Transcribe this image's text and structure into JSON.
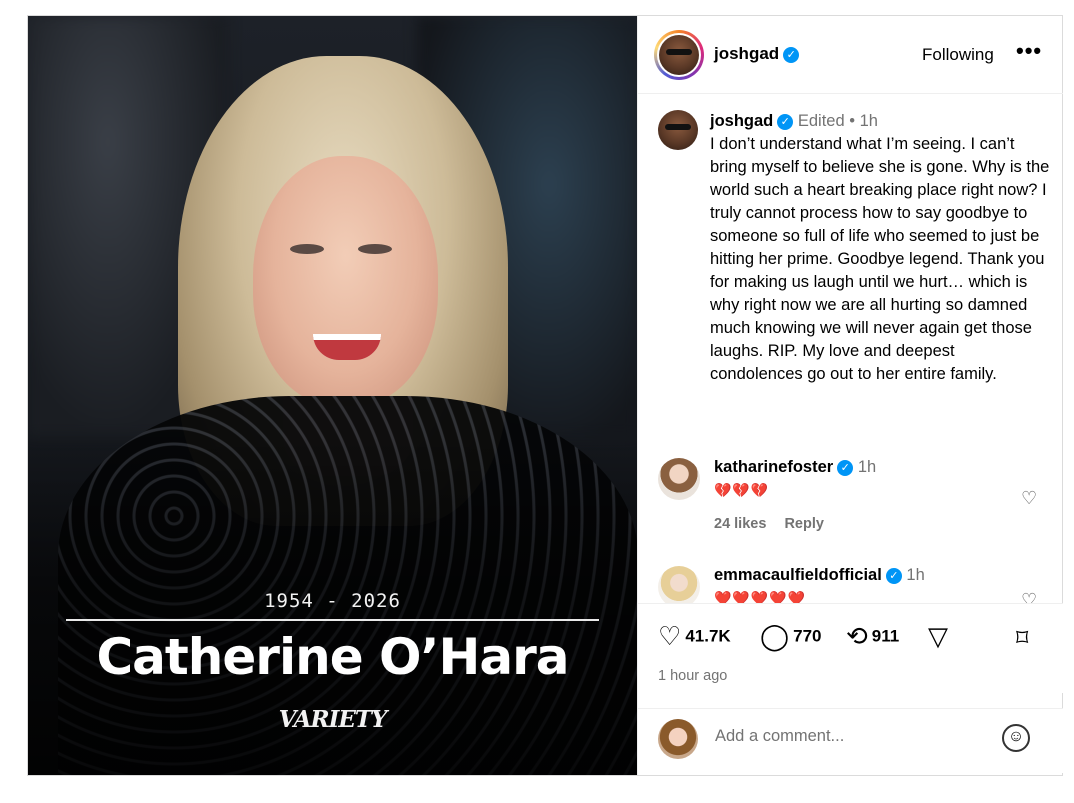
{
  "post_image": {
    "years": "1954 - 2026",
    "name": "Catherine O’Hara",
    "brand": "VARIETY"
  },
  "header": {
    "username": "joshgad",
    "follow_label": "Following",
    "more_label": "•••"
  },
  "caption": {
    "username": "joshgad",
    "edited": "Edited",
    "dot": "•",
    "time": "1h",
    "text": "I don’t understand what I’m seeing. I can’t bring myself to believe she is gone. Why is the world such a heart breaking place right now? I truly cannot process how to say goodbye to someone so full of life who seemed to just be hitting her prime. Goodbye legend. Thank you for making us laugh until we hurt… which is why right now we are all hurting so damned much knowing we will never again get those laughs. RIP. My love and deepest condolences go out to her entire family."
  },
  "comments": [
    {
      "username": "katharinefoster",
      "time": "1h",
      "emoji": "💔💔💔",
      "likes": "24 likes",
      "reply": "Reply"
    },
    {
      "username": "emmacaulfieldofficial",
      "time": "1h",
      "emoji": "❤️❤️❤️❤️❤️"
    }
  ],
  "actions": {
    "likes": "41.7K",
    "comments": "770",
    "reposts": "911",
    "posted": "1 hour ago"
  },
  "add_comment": {
    "placeholder": "Add a comment..."
  },
  "icons": {
    "verified": "verified-badge-icon",
    "heart": "heart-icon",
    "comment": "comment-bubble-icon",
    "repost": "repost-icon",
    "share": "send-icon",
    "bookmark": "bookmark-icon",
    "emoji": "smiley-icon"
  },
  "colors": {
    "verified": "#0095f6",
    "meta_text": "#737373",
    "border": "#dbdbdb"
  }
}
